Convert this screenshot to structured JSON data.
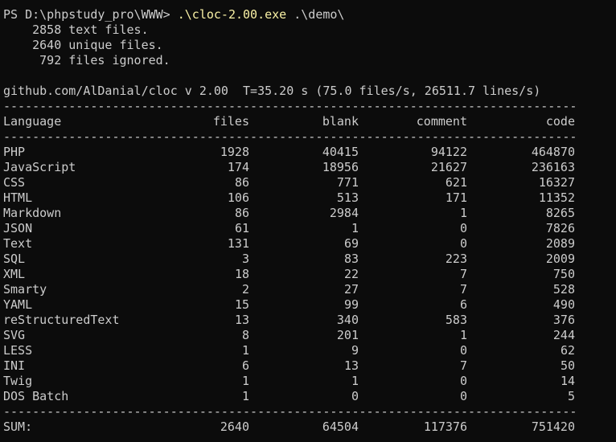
{
  "prompt": {
    "ps": "PS D:\\phpstudy_pro\\WWW> ",
    "command": ".\\cloc-2.00.exe",
    "argument": " .\\demo\\"
  },
  "summary_lines": [
    "    2858 text files.",
    "    2640 unique files.",
    "     792 files ignored."
  ],
  "header_line": "github.com/AlDanial/cloc v 2.00  T=35.20 s (75.0 files/s, 26511.7 lines/s)",
  "rule": "-------------------------------------------------------------------------------",
  "columns": {
    "language": "Language",
    "files": "files",
    "blank": "blank",
    "comment": "comment",
    "code": "code"
  },
  "rows": [
    {
      "language": "PHP",
      "files": "1928",
      "blank": "40415",
      "comment": "94122",
      "code": "464870"
    },
    {
      "language": "JavaScript",
      "files": "174",
      "blank": "18956",
      "comment": "21627",
      "code": "236163"
    },
    {
      "language": "CSS",
      "files": "86",
      "blank": "771",
      "comment": "621",
      "code": "16327"
    },
    {
      "language": "HTML",
      "files": "106",
      "blank": "513",
      "comment": "171",
      "code": "11352"
    },
    {
      "language": "Markdown",
      "files": "86",
      "blank": "2984",
      "comment": "1",
      "code": "8265"
    },
    {
      "language": "JSON",
      "files": "61",
      "blank": "1",
      "comment": "0",
      "code": "7826"
    },
    {
      "language": "Text",
      "files": "131",
      "blank": "69",
      "comment": "0",
      "code": "2089"
    },
    {
      "language": "SQL",
      "files": "3",
      "blank": "83",
      "comment": "223",
      "code": "2009"
    },
    {
      "language": "XML",
      "files": "18",
      "blank": "22",
      "comment": "7",
      "code": "750"
    },
    {
      "language": "Smarty",
      "files": "2",
      "blank": "27",
      "comment": "7",
      "code": "528"
    },
    {
      "language": "YAML",
      "files": "15",
      "blank": "99",
      "comment": "6",
      "code": "490"
    },
    {
      "language": "reStructuredText",
      "files": "13",
      "blank": "340",
      "comment": "583",
      "code": "376"
    },
    {
      "language": "SVG",
      "files": "8",
      "blank": "201",
      "comment": "1",
      "code": "244"
    },
    {
      "language": "LESS",
      "files": "1",
      "blank": "9",
      "comment": "0",
      "code": "62"
    },
    {
      "language": "INI",
      "files": "6",
      "blank": "13",
      "comment": "7",
      "code": "50"
    },
    {
      "language": "Twig",
      "files": "1",
      "blank": "1",
      "comment": "0",
      "code": "14"
    },
    {
      "language": "DOS Batch",
      "files": "1",
      "blank": "0",
      "comment": "0",
      "code": "5"
    }
  ],
  "sum": {
    "language": "SUM:",
    "files": "2640",
    "blank": "64504",
    "comment": "117376",
    "code": "751420"
  },
  "colors": {
    "background": "#0c0c0c",
    "text": "#cccccc",
    "command": "#f9f1a5"
  }
}
